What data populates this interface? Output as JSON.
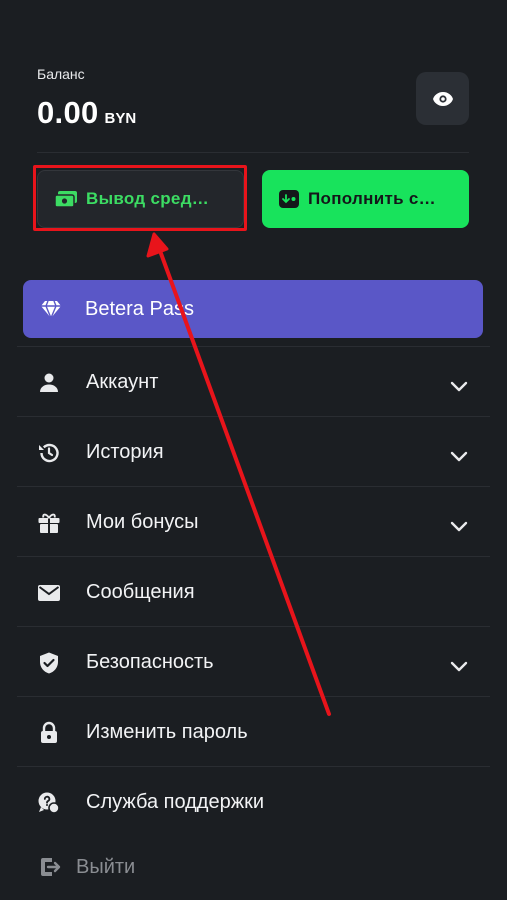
{
  "balance": {
    "label": "Баланс",
    "amount": "0.00",
    "currency": "BYN"
  },
  "visibility_toggle": {
    "icon": "eye-icon"
  },
  "actions": {
    "withdraw_label": "Вывод сред…",
    "deposit_label": "Пополнить с…"
  },
  "pass": {
    "label": "Betera Pass",
    "icon": "diamond-icon"
  },
  "menu": [
    {
      "label": "Аккаунт",
      "icon": "user-icon",
      "expandable": true
    },
    {
      "label": "История",
      "icon": "history-icon",
      "expandable": true
    },
    {
      "label": "Мои бонусы",
      "icon": "gift-icon",
      "expandable": true
    },
    {
      "label": "Сообщения",
      "icon": "mail-icon",
      "expandable": false
    },
    {
      "label": "Безопасность",
      "icon": "shield-icon",
      "expandable": true
    },
    {
      "label": "Изменить пароль",
      "icon": "lock-icon",
      "expandable": false
    },
    {
      "label": "Служба поддержки",
      "icon": "support-icon",
      "expandable": false
    }
  ],
  "logout": {
    "label": "Выйти",
    "icon": "logout-icon"
  },
  "colors": {
    "background": "#1b1e22",
    "accent_green": "#18e35c",
    "pass_purple": "#5a57c7",
    "annotation_red": "#e8141b"
  }
}
